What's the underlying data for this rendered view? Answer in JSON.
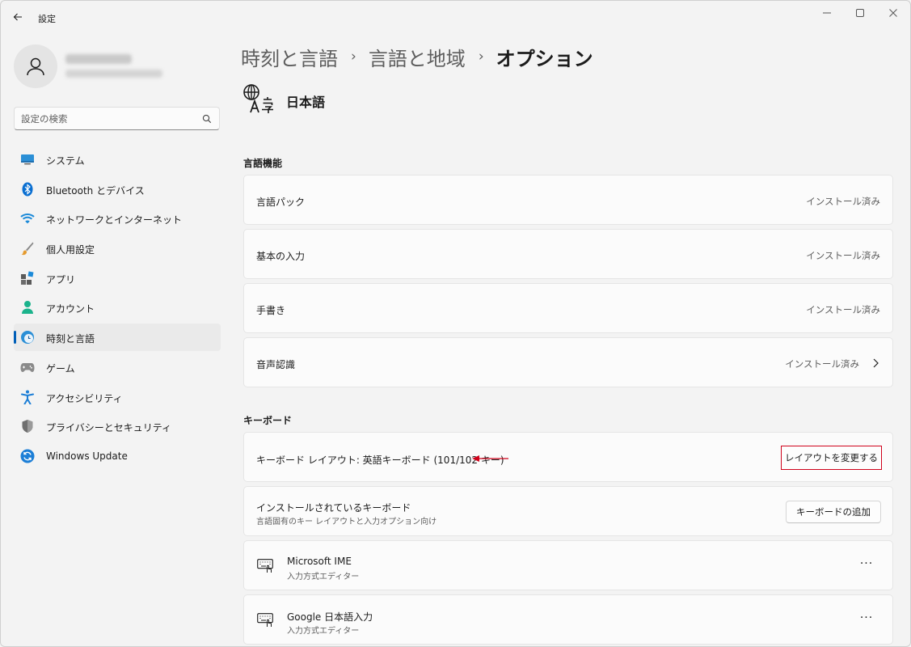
{
  "window": {
    "title": "設定",
    "back_icon": "arrow-left-icon",
    "minimize_icon": "minimize-icon",
    "maximize_icon": "maximize-icon",
    "close_icon": "close-icon"
  },
  "sidebar": {
    "search": {
      "placeholder": "設定の検索",
      "value": ""
    },
    "items": [
      {
        "label": "システム",
        "icon": "system-monitor-icon",
        "active": false
      },
      {
        "label": "Bluetooth とデバイス",
        "icon": "bluetooth-icon",
        "active": false
      },
      {
        "label": "ネットワークとインターネット",
        "icon": "wifi-icon",
        "active": false
      },
      {
        "label": "個人用設定",
        "icon": "brush-icon",
        "active": false
      },
      {
        "label": "アプリ",
        "icon": "apps-icon",
        "active": false
      },
      {
        "label": "アカウント",
        "icon": "account-icon",
        "active": false
      },
      {
        "label": "時刻と言語",
        "icon": "time-language-icon",
        "active": true
      },
      {
        "label": "ゲーム",
        "icon": "gamepad-icon",
        "active": false
      },
      {
        "label": "アクセシビリティ",
        "icon": "accessibility-icon",
        "active": false
      },
      {
        "label": "プライバシーとセキュリティ",
        "icon": "shield-icon",
        "active": false
      },
      {
        "label": "Windows Update",
        "icon": "update-icon",
        "active": false
      }
    ]
  },
  "breadcrumb": {
    "items": [
      "時刻と言語",
      "言語と地域"
    ],
    "current": "オプション",
    "separator": "›"
  },
  "language": {
    "name": "日本語",
    "icon": "language-icon"
  },
  "language_features": {
    "title": "言語機能",
    "items": [
      {
        "label": "言語パック",
        "status": "インストール済み"
      },
      {
        "label": "基本の入力",
        "status": "インストール済み"
      },
      {
        "label": "手書き",
        "status": "インストール済み"
      },
      {
        "label": "音声認識",
        "status": "インストール済み"
      }
    ]
  },
  "keyboard": {
    "title": "キーボード",
    "layout_label": "キーボード レイアウト: 英語キーボード (101/102 キー)",
    "change_layout_button": "レイアウトを変更する",
    "installed_title": "インストールされているキーボード",
    "installed_sub": "言語固有のキー レイアウトと入力オプション向け",
    "add_keyboard_button": "キーボードの追加",
    "imes": [
      {
        "name": "Microsoft IME",
        "sub": "入力方式エディター",
        "more": "···"
      },
      {
        "name": "Google 日本語入力",
        "sub": "入力方式エディター",
        "more": "···"
      }
    ]
  },
  "colors": {
    "accent": "#005fb8",
    "highlight_border": "#d0021b",
    "annotation_arrow": "#d0021b"
  }
}
